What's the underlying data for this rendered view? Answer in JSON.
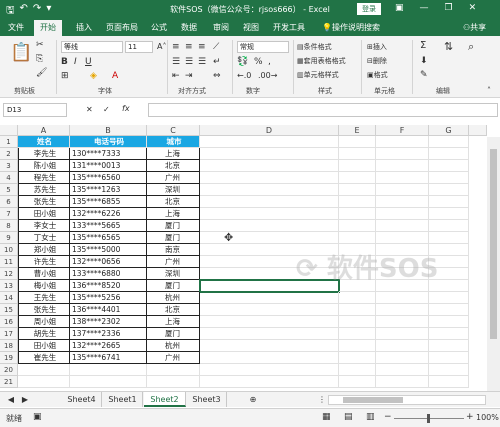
{
  "titlebar": {
    "title": "软件SOS（微信公众号：rjsos666） - Excel",
    "signin": "登录"
  },
  "tabs": [
    "文件",
    "开始",
    "插入",
    "页面布局",
    "公式",
    "数据",
    "审阅",
    "视图",
    "开发工具",
    "操作说明搜索",
    "共享"
  ],
  "ribbon": {
    "font_name": "等线",
    "font_size": "11",
    "number_format": "常规",
    "groups": [
      "剪贴板",
      "字体",
      "对齐方式",
      "数字",
      "样式",
      "单元格",
      "编辑"
    ],
    "cond_format": "条件格式",
    "table_format": "套用表格格式",
    "cell_style": "单元格样式",
    "insert": "插入",
    "delete": "删除",
    "format": "格式"
  },
  "namebox": "D13",
  "fx_label": "fx",
  "columns": [
    "A",
    "B",
    "C",
    "D",
    "E",
    "F",
    "G"
  ],
  "headers": [
    "姓名",
    "电话号码",
    "城市"
  ],
  "rows": [
    [
      "李先生",
      "130****7333",
      "上海"
    ],
    [
      "陈小姐",
      "131****0013",
      "北京"
    ],
    [
      "程先生",
      "135****6560",
      "广州"
    ],
    [
      "苏先生",
      "135****1263",
      "深圳"
    ],
    [
      "张先生",
      "135****6855",
      "北京"
    ],
    [
      "田小姐",
      "132****6226",
      "上海"
    ],
    [
      "李女士",
      "133****5665",
      "厦门"
    ],
    [
      "丁女士",
      "135****6565",
      "厦门"
    ],
    [
      "郑小姐",
      "135****5000",
      "南京"
    ],
    [
      "许先生",
      "132****0656",
      "广州"
    ],
    [
      "曹小姐",
      "133****6880",
      "深圳"
    ],
    [
      "梅小姐",
      "136****8520",
      "厦门"
    ],
    [
      "王先生",
      "135****5256",
      "杭州"
    ],
    [
      "张先生",
      "136****4401",
      "北京"
    ],
    [
      "周小姐",
      "138****2302",
      "上海"
    ],
    [
      "胡先生",
      "137****2336",
      "厦门"
    ],
    [
      "田小姐",
      "132****2665",
      "杭州"
    ],
    [
      "崔先生",
      "135****6741",
      "广州"
    ]
  ],
  "sheets": [
    "Sheet4",
    "Sheet1",
    "Sheet2",
    "Sheet3"
  ],
  "status": {
    "ready": "就绪",
    "zoom": "100%"
  },
  "watermark": "软件SOS"
}
